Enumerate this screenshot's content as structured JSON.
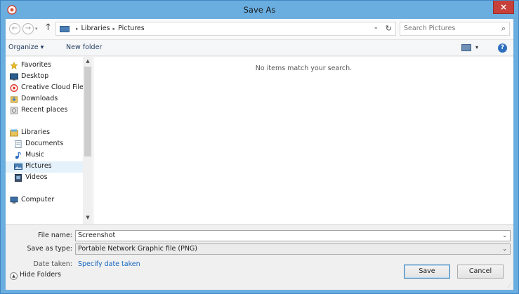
{
  "window": {
    "title": "Save As",
    "close_glyph": "×"
  },
  "nav": {
    "back_glyph": "←",
    "forward_glyph": "→",
    "recent_glyph": "▾",
    "up_glyph": "↑"
  },
  "address": {
    "crumbs": [
      "Libraries",
      "Pictures"
    ],
    "separator": "▸",
    "dropdown_glyph": "⌄",
    "refresh_glyph": "↻"
  },
  "search": {
    "placeholder": "Search Pictures",
    "icon_glyph": "⌕"
  },
  "toolbar": {
    "organize_label": "Organize ▾",
    "new_folder_label": "New folder",
    "view_dropdown_glyph": "▾",
    "help_glyph": "?"
  },
  "sidebar": {
    "items": [
      {
        "label": "Favorites",
        "icon": "star-icon",
        "color": "#e8b923"
      },
      {
        "label": "Desktop",
        "icon": "desktop-icon",
        "color": "#2c5d8f"
      },
      {
        "label": "Creative Cloud Files",
        "icon": "creative-cloud-icon",
        "color": "#e03a2e"
      },
      {
        "label": "Downloads",
        "icon": "downloads-icon",
        "color": "#3b7fd1"
      },
      {
        "label": "Recent places",
        "icon": "recent-places-icon",
        "color": "#8a8a8a"
      },
      {
        "label": "Libraries",
        "icon": "libraries-icon",
        "color": "#d9a93b"
      },
      {
        "label": "Documents",
        "icon": "documents-icon",
        "color": "#7a8fa8"
      },
      {
        "label": "Music",
        "icon": "music-icon",
        "color": "#2b6cc4"
      },
      {
        "label": "Pictures",
        "icon": "pictures-icon",
        "color": "#4a7fb5",
        "selected": true
      },
      {
        "label": "Videos",
        "icon": "videos-icon",
        "color": "#3a4f6b"
      },
      {
        "label": "Computer",
        "icon": "computer-icon",
        "color": "#3a6ea5"
      }
    ],
    "scroll_up_glyph": "▲",
    "scroll_down_glyph": "▼"
  },
  "content": {
    "empty_message": "No items match your search."
  },
  "form": {
    "file_name_label": "File name:",
    "file_name_value": "Screenshot",
    "save_as_type_label": "Save as type:",
    "save_as_type_value": "Portable Network Graphic file (PNG)",
    "date_taken_label": "Date taken:",
    "date_taken_link": "Specify date taken",
    "dropdown_glyph": "⌄"
  },
  "footer": {
    "hide_folders_label": "Hide Folders",
    "hide_folders_glyph": "▲",
    "save_label": "Save",
    "cancel_label": "Cancel",
    "grip_glyph": "⋰"
  },
  "colors": {
    "titlebar": "#6aaee0",
    "close": "#c7413a",
    "link": "#1565c0",
    "selection": "#e5f1fb"
  }
}
